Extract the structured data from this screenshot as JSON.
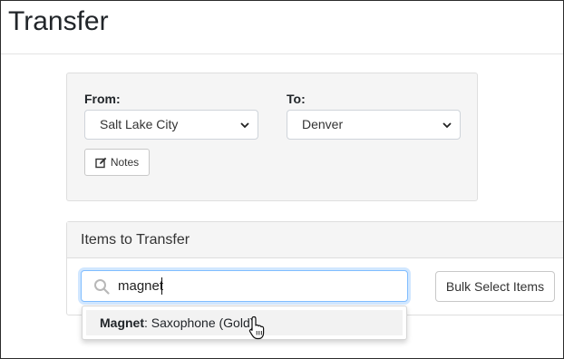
{
  "page": {
    "title": "Transfer"
  },
  "transfer": {
    "from_label": "From:",
    "from_value": "Salt Lake City",
    "to_label": "To:",
    "to_value": "Denver",
    "notes_label": "Notes"
  },
  "items": {
    "header": "Items to Transfer",
    "search_value": "magnet",
    "bulk_label": "Bulk Select Items",
    "suggestion": {
      "match": "Magnet",
      "rest": ": Saxophone (Gold)"
    }
  },
  "icons": {
    "search": "search-icon",
    "notes": "edit-icon",
    "chevron": "chevron-down-icon",
    "cursor": "hand-pointer-icon"
  }
}
